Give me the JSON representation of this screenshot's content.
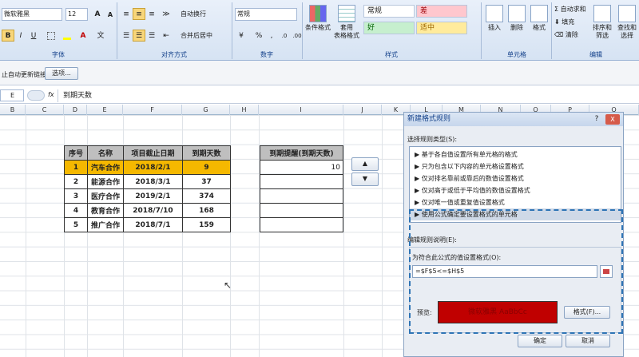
{
  "ribbon": {
    "font_name": "微软雅黑",
    "font_size": "12",
    "grow_label": "A",
    "shrink_label": "A",
    "bold": "B",
    "italic": "I",
    "underline": "U",
    "wrap_text": "自动换行",
    "merge_center": "合并后居中",
    "number_format": "常规",
    "percent": "%",
    "comma": ",",
    "inc_decimal": ".0",
    "dec_decimal": ".00",
    "conditional_format": "条件格式",
    "table_format": "套用\n表格格式",
    "style_normal": "常规",
    "style_bad": "差",
    "style_good": "好",
    "style_neutral": "适中",
    "insert": "插入",
    "delete": "删除",
    "format": "格式",
    "autosum": "自动求和",
    "fill": "填充",
    "clear": "清除",
    "sort_filter": "排序和\n筛选",
    "find_select": "查找和\n选择",
    "groups": {
      "font": "字体",
      "align": "对齐方式",
      "number": "数字",
      "styles": "样式",
      "cells": "单元格",
      "editing": "编辑"
    }
  },
  "message_bar": {
    "text": "止自动更新链接",
    "options_button": "选项..."
  },
  "formula_bar": {
    "cell_ref": "E",
    "fx": "fx",
    "content": "到期天数"
  },
  "columns": [
    "B",
    "C",
    "D",
    "E",
    "F",
    "G",
    "H",
    "I",
    "J",
    "K",
    "L",
    "M",
    "N",
    "O",
    "P",
    "Q"
  ],
  "main_table": {
    "headers": [
      "序号",
      "名称",
      "项目截止日期",
      "到期天数"
    ],
    "rows": [
      [
        "1",
        "汽车合作",
        "2018/2/1",
        "9"
      ],
      [
        "2",
        "能源合作",
        "2018/3/1",
        "37"
      ],
      [
        "3",
        "医疗合作",
        "2019/2/1",
        "374"
      ],
      [
        "4",
        "教育合作",
        "2018/7/10",
        "168"
      ],
      [
        "5",
        "推广合作",
        "2018/7/1",
        "159"
      ]
    ]
  },
  "reminder_table": {
    "header": "到期提醒(到期天数)",
    "value": "10"
  },
  "spinner": {
    "up": "▲",
    "down": "▼"
  },
  "dialog": {
    "title": "新建格式规则",
    "help": "?",
    "close": "X",
    "rule_type_label": "选择规则类型(S):",
    "rules": [
      "基于各自值设置所有单元格的格式",
      "只为包含以下内容的单元格设置格式",
      "仅对排名靠前或靠后的数值设置格式",
      "仅对高于或低于平均值的数值设置格式",
      "仅对唯一值或重复值设置格式",
      "使用公式确定要设置格式的单元格"
    ],
    "edit_label": "编辑规则说明(E):",
    "formula_label": "为符合此公式的值设置格式(O):",
    "formula": "=$F$5<=$H$5",
    "preview_label": "预览:",
    "preview_text": "微软雅黑  AaBbCc",
    "format_button": "格式(F)...",
    "ok": "确定",
    "cancel": "取消"
  },
  "colors": {
    "accent": "#f5b800",
    "preview_bg": "#c00000",
    "header_gray": "#bfbfbf"
  }
}
